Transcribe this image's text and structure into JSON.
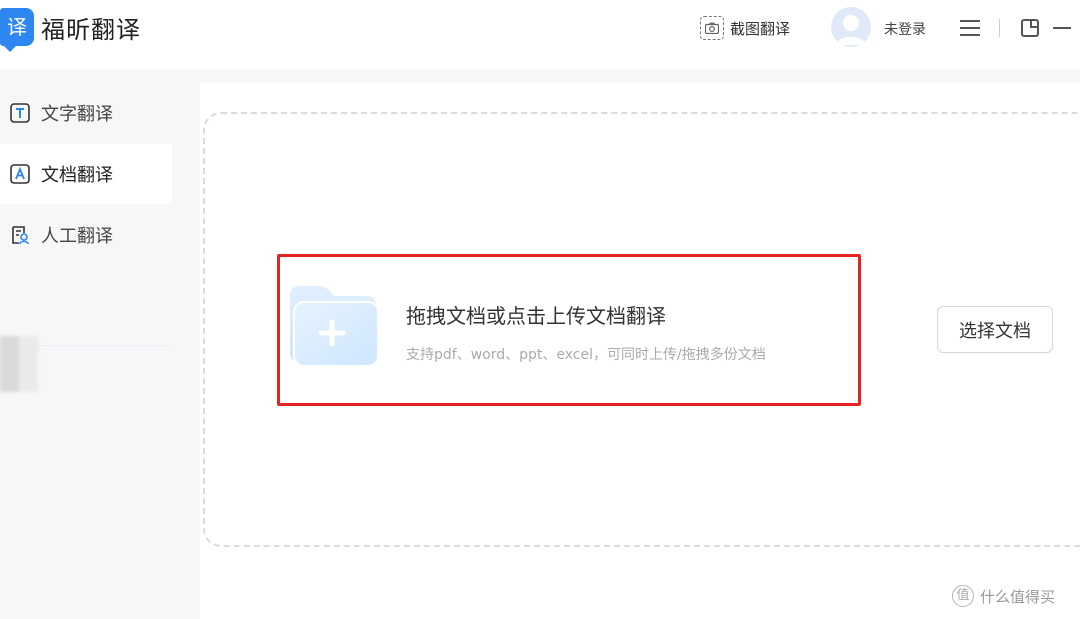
{
  "app": {
    "logo_char": "译",
    "title": "福昕翻译"
  },
  "header": {
    "screenshot_label": "截图翻译",
    "login_label": "未登录",
    "icons": [
      "camera-icon",
      "avatar",
      "menu-icon",
      "restore-icon",
      "minimize-icon"
    ]
  },
  "sidebar": {
    "items": [
      {
        "label": "文字翻译",
        "icon": "text-t-icon",
        "active": false
      },
      {
        "label": "文档翻译",
        "icon": "document-a-icon",
        "active": true
      },
      {
        "label": "人工翻译",
        "icon": "human-translate-icon",
        "active": false
      }
    ]
  },
  "dropzone": {
    "title": "拖拽文档或点击上传文档翻译",
    "subtitle": "支持pdf、word、ppt、excel，可同时上传/拖拽多份文档",
    "select_button": "选择文档"
  },
  "watermark": {
    "icon_char": "值",
    "text": "什么值得买"
  },
  "colors": {
    "brand_blue": "#2e86f0",
    "highlight_red": "#e52421",
    "sidebar_bg": "#f6f7f9"
  }
}
